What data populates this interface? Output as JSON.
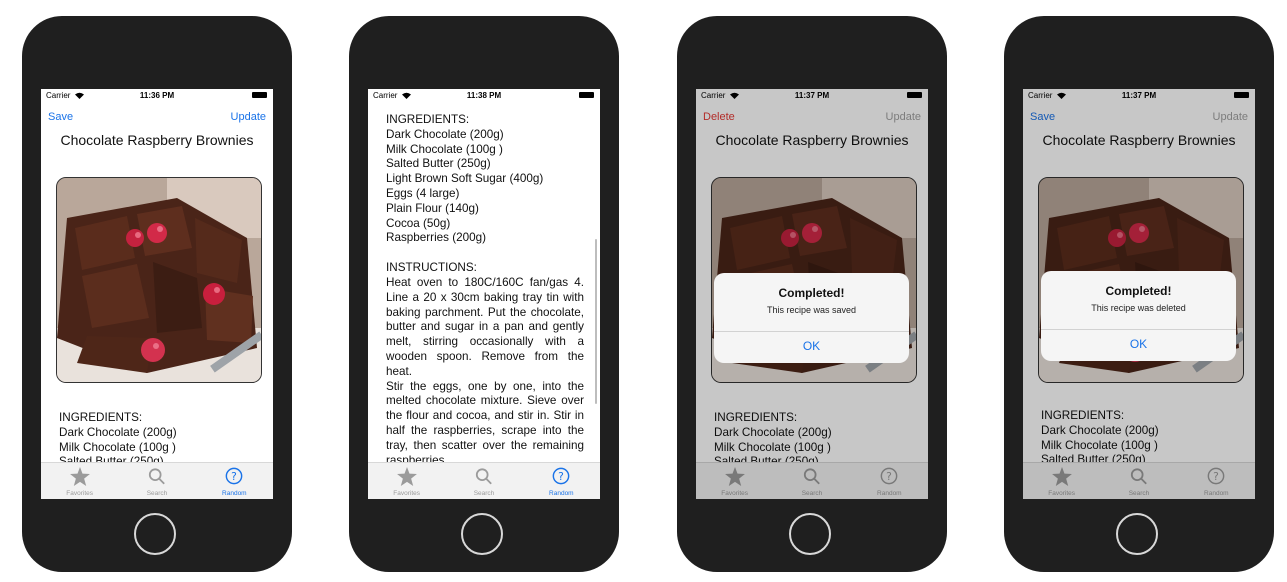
{
  "status": {
    "carrier": "Carrier"
  },
  "screens": [
    {
      "time": "11:36 PM",
      "left_btn": "Save",
      "right_btn": "Update",
      "title": "Chocolate Raspberry Brownies"
    },
    {
      "time": "11:38 PM"
    },
    {
      "time": "11:37 PM",
      "left_btn": "Delete",
      "right_btn": "Update",
      "title": "Chocolate Raspberry Brownies",
      "alert": {
        "title": "Completed!",
        "message": "This recipe was saved",
        "ok": "OK"
      }
    },
    {
      "time": "11:37 PM",
      "left_btn": "Save",
      "right_btn": "Update",
      "title": "Chocolate Raspberry Brownies",
      "alert": {
        "title": "Completed!",
        "message": "This recipe was deleted",
        "ok": "OK"
      }
    }
  ],
  "recipe": {
    "ingredients_header": "INGREDIENTS:",
    "ingredients": [
      "Dark Chocolate (200g)",
      "Milk Chocolate (100g )",
      "Salted Butter (250g)",
      "Light Brown Soft Sugar (400g)",
      "Eggs (4 large)",
      "Plain Flour (140g)",
      "Cocoa (50g)",
      "Raspberries (200g)"
    ],
    "instructions_header": "INSTRUCTIONS:",
    "instructions_1": "Heat oven to 180C/160C fan/gas 4. Line a 20 x 30cm baking tray tin with baking parchment. Put the chocolate, butter and sugar in a pan and gently melt, stirring occasionally with a wooden spoon. Remove from the heat.",
    "instructions_2": "Stir the eggs, one by one, into the melted chocolate mixture. Sieve over the flour and cocoa, and stir in. Stir in half the raspberries, scrape into the tray, then scatter over the remaining raspberries."
  },
  "tabs": [
    {
      "label": "Favorites",
      "icon": "star-icon"
    },
    {
      "label": "Search",
      "icon": "search-icon"
    },
    {
      "label": "Random",
      "icon": "question-circle-icon"
    }
  ],
  "colors": {
    "accent": "#1a73e8",
    "delete": "#e53935",
    "phone_body": "#1f1f1f"
  }
}
